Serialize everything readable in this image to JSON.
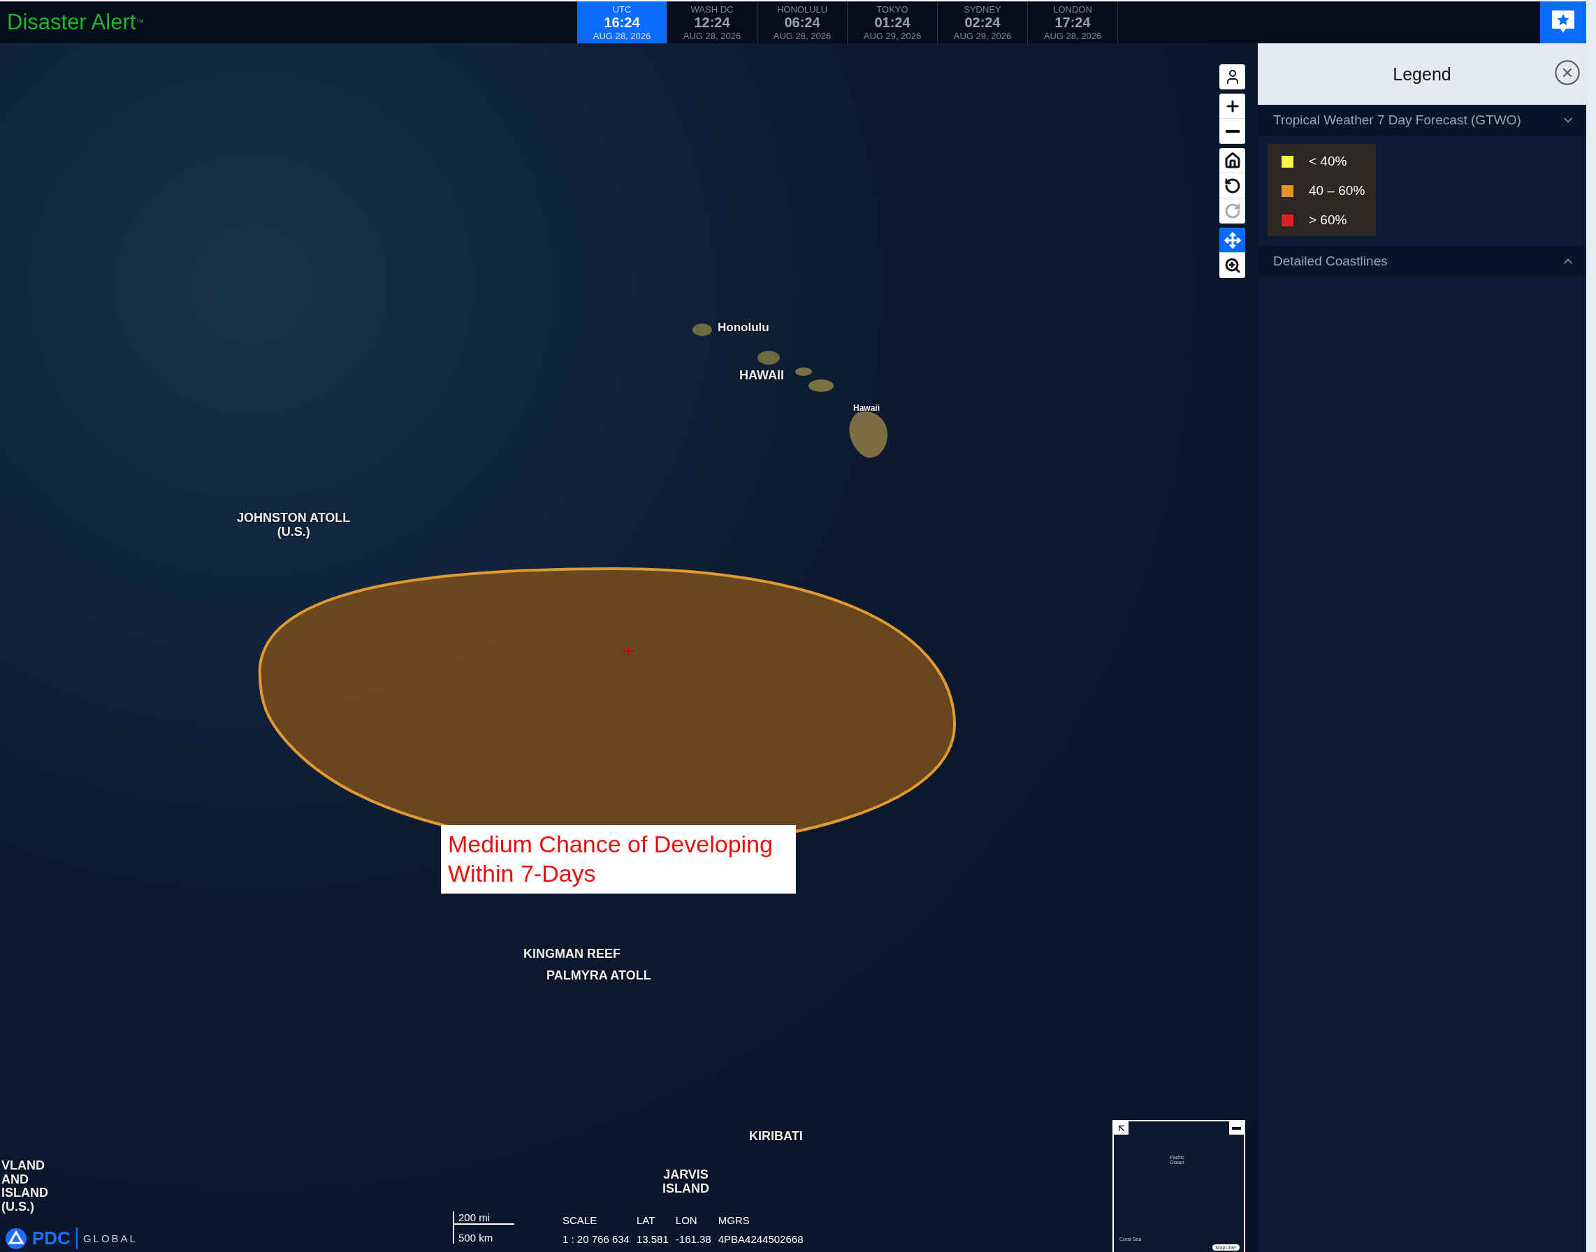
{
  "header": {
    "title": "Disaster Alert",
    "trademark": "™",
    "clocks": [
      {
        "city": "UTC",
        "time": "16:24",
        "date": "AUG 28, 2026",
        "selected": true
      },
      {
        "city": "WASH DC",
        "time": "12:24",
        "date": "AUG 28, 2026",
        "selected": false
      },
      {
        "city": "HONOLULU",
        "time": "06:24",
        "date": "AUG 28, 2026",
        "selected": false
      },
      {
        "city": "TOKYO",
        "time": "01:24",
        "date": "AUG 29, 2026",
        "selected": false
      },
      {
        "city": "SYDNEY",
        "time": "02:24",
        "date": "AUG 29, 2026",
        "selected": false
      },
      {
        "city": "LONDON",
        "time": "17:24",
        "date": "AUG 28, 2026",
        "selected": false
      }
    ]
  },
  "map": {
    "labels": [
      {
        "text": "Honolulu",
        "kind": "city"
      },
      {
        "text": "HAWAII",
        "kind": "region"
      },
      {
        "text": "Hawaii",
        "kind": "island"
      },
      {
        "text": "JOHNSTON ATOLL\n(U.S.)",
        "kind": "region"
      },
      {
        "text": "KINGMAN REEF",
        "kind": "region"
      },
      {
        "text": "PALMYRA ATOLL",
        "kind": "region"
      },
      {
        "text": "KIRIBATI",
        "kind": "region"
      },
      {
        "text": "VLAND\nAND",
        "kind": "edge"
      },
      {
        "text": "ISLAND\n(U.S.)",
        "kind": "edge"
      },
      {
        "text": "JARVIS\nISLAND",
        "kind": "region"
      }
    ],
    "annotation": "Medium Chance of Developing Within 7-Days",
    "tool_groups": [
      {
        "tools": [
          {
            "kind": "person",
            "selected": false,
            "disabled": false
          }
        ]
      },
      {
        "tools": [
          {
            "kind": "zoom-in",
            "selected": false,
            "disabled": false
          },
          {
            "kind": "zoom-out",
            "selected": false,
            "disabled": false
          }
        ]
      },
      {
        "tools": [
          {
            "kind": "home",
            "selected": false,
            "disabled": false
          },
          {
            "kind": "rotate-left",
            "selected": false,
            "disabled": false
          },
          {
            "kind": "rotate-right",
            "selected": false,
            "disabled": true
          }
        ]
      },
      {
        "tools": [
          {
            "kind": "pan",
            "selected": true,
            "disabled": false
          },
          {
            "kind": "zoom-box",
            "selected": false,
            "disabled": false
          }
        ]
      }
    ],
    "scale_bar": {
      "miles": "200 mi",
      "km": "500 km"
    },
    "readouts": [
      {
        "label": "SCALE",
        "value": "1 : 20 766 634"
      },
      {
        "label": "LAT",
        "value": "13.581"
      },
      {
        "label": "LON",
        "value": "-161.38"
      },
      {
        "label": "MGRS",
        "value": "4PBA4244502668"
      }
    ],
    "logo": {
      "brand": "PDC",
      "suffix": "GLOBAL"
    },
    "overview": {
      "labels": [
        "Pacific\nOcean",
        "Coral Sea"
      ],
      "attribution": "MapLibre"
    }
  },
  "legend": {
    "title": "Legend",
    "sections": [
      {
        "title": "Tropical Weather 7 Day Forecast (GTWO)",
        "expanded": true,
        "items": [
          {
            "label": "< 40%",
            "color": "#f5f542"
          },
          {
            "label": "40 – 60%",
            "color": "#e8902a"
          },
          {
            "label": "> 60%",
            "color": "#e02020"
          }
        ]
      },
      {
        "title": "Detailed Coastlines",
        "expanded": false
      }
    ]
  }
}
